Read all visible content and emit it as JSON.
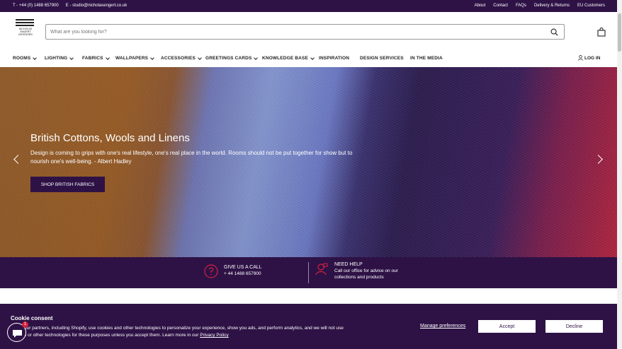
{
  "topbar": {
    "phone": "T - +44 (0) 1488 657900",
    "email": "E - studio@nicholasengert.co.uk",
    "links": [
      "About",
      "Contact",
      "FAQs",
      "Delivery & Returns",
      "EU Customers"
    ]
  },
  "logo": {
    "line1": "NICHOLAS",
    "line2": "ENGERT",
    "line3": "INTERIORS"
  },
  "search": {
    "placeholder": "What are you looking for?"
  },
  "nav": {
    "items": [
      "ROOMS",
      "LIGHTING",
      "FABRICS",
      "WALLPAPERS",
      "ACCESSORIES",
      "GREETINGS CARDS",
      "KNOWLEDGE BASE",
      "INSPIRATION",
      "DESIGN SERVICES",
      "IN THE MEDIA"
    ],
    "login": "LOG IN"
  },
  "hero": {
    "title": "British Cottons, Wools and Linens",
    "quote": "Design is coming to grips with one's real lifestyle, one's real place in the world. Rooms should not be put together for show but to nourish one's well-being. - Albert Hadley",
    "cta": "SHOP BRITISH FABRICS"
  },
  "help": {
    "call_title": "GIVE US A CALL",
    "call_number": "+ 44 1488 657900",
    "need_title": "NEED HELP",
    "need_line1": "Call our office for advice on our",
    "need_line2": "collections and products"
  },
  "cookie": {
    "title": "Cookie consent",
    "line1": "our partners, including Shopify, use cookies and other technologies to personalize your experience, show you ads, and perform analytics, and we will not use",
    "line2": "s or other technologies for these purposes unless you accept them. Learn more in our",
    "policy_link": "Privacy Policy",
    "manage": "Manage preferences",
    "accept": "Accept",
    "decline": "Decline"
  },
  "chat": {
    "badge": "1"
  },
  "colors": {
    "brand": "#2e1246",
    "badge": "#d4213d"
  }
}
